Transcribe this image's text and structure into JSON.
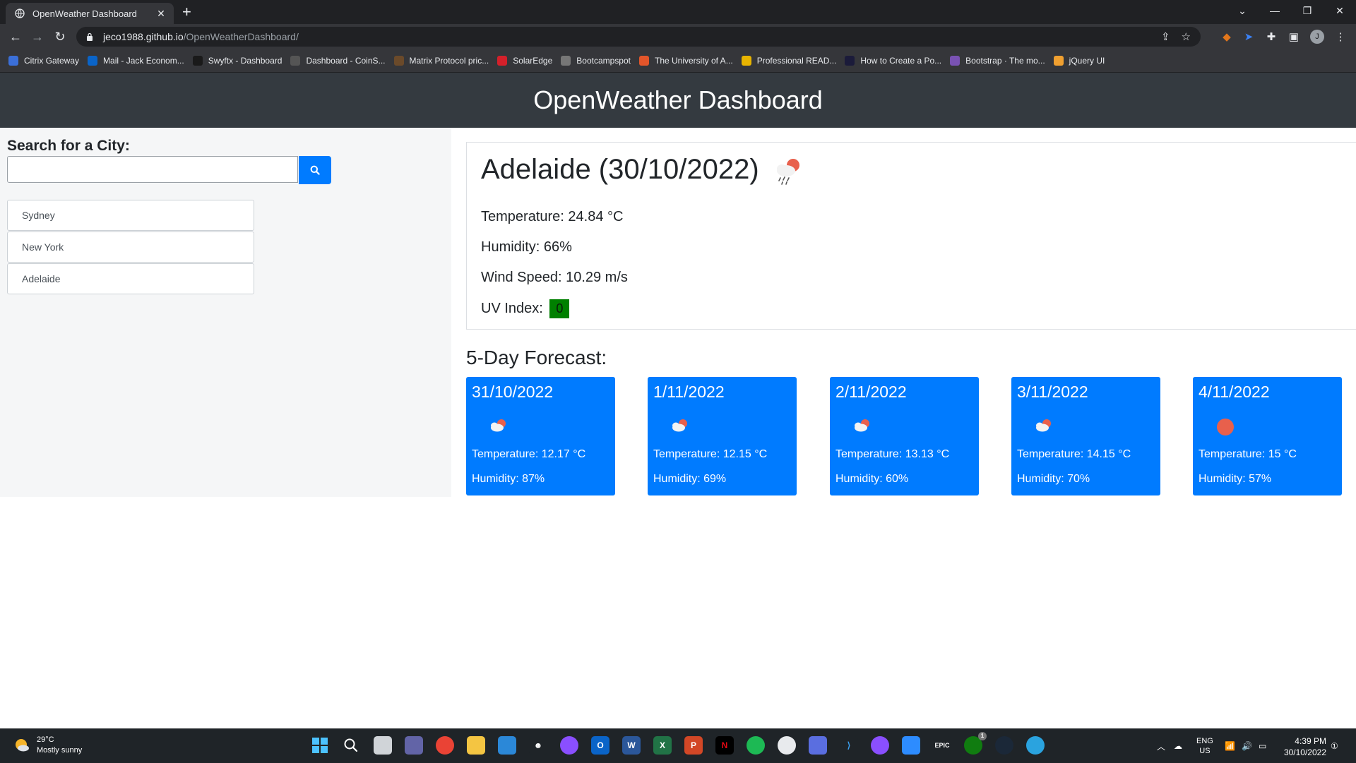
{
  "browser": {
    "tab_title": "OpenWeather Dashboard",
    "tab_close": "✕",
    "new_tab": "+",
    "url_host": "jeco1988.github.io",
    "url_path": "/OpenWeatherDashboard/",
    "profile_initial": "J",
    "bookmarks": [
      {
        "label": "Citrix Gateway",
        "color": "#3b6fd8"
      },
      {
        "label": "Mail - Jack Econom...",
        "color": "#0a64c8"
      },
      {
        "label": "Swyftx - Dashboard",
        "color": "#1a1a1a"
      },
      {
        "label": "Dashboard - CoinS...",
        "color": "#555555"
      },
      {
        "label": "Matrix Protocol pric...",
        "color": "#6b4a2a"
      },
      {
        "label": "SolarEdge",
        "color": "#d4202a"
      },
      {
        "label": "Bootcampspot",
        "color": "#777777"
      },
      {
        "label": "The University of A...",
        "color": "#e2552a"
      },
      {
        "label": "Professional READ...",
        "color": "#e8b400"
      },
      {
        "label": "How to Create a Po...",
        "color": "#1b1b3a"
      },
      {
        "label": "Bootstrap · The mo...",
        "color": "#7952b3"
      },
      {
        "label": "jQuery UI",
        "color": "#f0a030"
      }
    ]
  },
  "app": {
    "title": "OpenWeather Dashboard",
    "search_label": "Search for a City:",
    "search_value": "",
    "search_placeholder": "",
    "history": [
      "Sydney",
      "New York",
      "Adelaide"
    ]
  },
  "current": {
    "heading": "Adelaide (30/10/2022)",
    "icon": "rain-cloud-sun-icon",
    "temperature": "Temperature: 24.84 °C",
    "humidity": "Humidity: 66%",
    "wind": "Wind Speed: 10.29 m/s",
    "uv_label": "UV Index:",
    "uv_value": "0",
    "uv_color": "#008000"
  },
  "forecast": {
    "title": "5-Day Forecast:",
    "days": [
      {
        "date": "31/10/2022",
        "icon": "cloud-sun-icon",
        "temp": "Temperature: 12.17 °C",
        "humidity": "Humidity: 87%"
      },
      {
        "date": "1/11/2022",
        "icon": "cloud-sun-icon",
        "temp": "Temperature: 12.15 °C",
        "humidity": "Humidity: 69%"
      },
      {
        "date": "2/11/2022",
        "icon": "cloud-sun-icon",
        "temp": "Temperature: 13.13 °C",
        "humidity": "Humidity: 60%"
      },
      {
        "date": "3/11/2022",
        "icon": "cloud-sun-icon",
        "temp": "Temperature: 14.15 °C",
        "humidity": "Humidity: 70%"
      },
      {
        "date": "4/11/2022",
        "icon": "sun-icon",
        "temp": "Temperature: 15 °C",
        "humidity": "Humidity: 57%"
      }
    ],
    "card_color": "#007bff"
  },
  "taskbar": {
    "weather_temp": "29°C",
    "weather_desc": "Mostly sunny",
    "lang_top": "ENG",
    "lang_bottom": "US",
    "time": "4:39 PM",
    "date": "30/10/2022",
    "notification_count": "1"
  }
}
